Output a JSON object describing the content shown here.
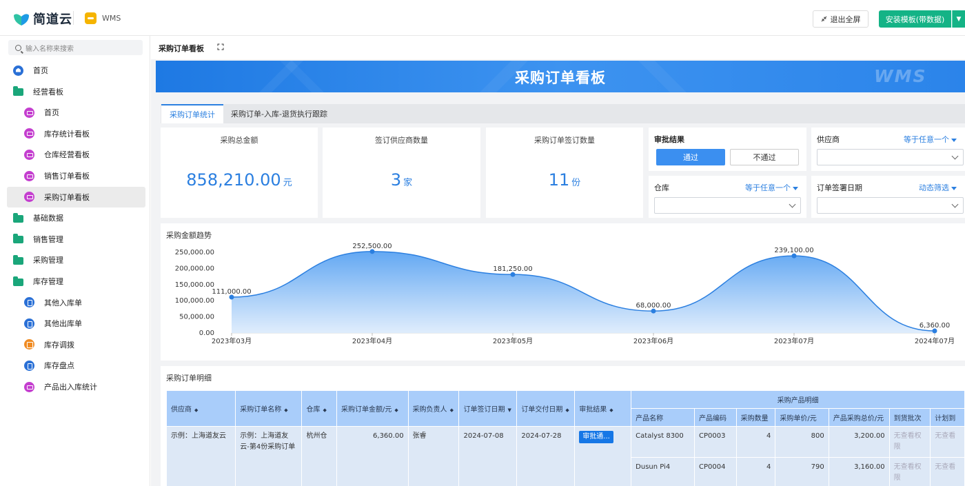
{
  "brand": {
    "name": "简道云",
    "app": "WMS"
  },
  "topbar": {
    "exit_label": "退出全屏",
    "install_label": "安装模板(带数据)"
  },
  "sidebar": {
    "search_placeholder": "输入名称来搜索",
    "items": [
      {
        "label": "首页",
        "icon": "home-icon"
      },
      {
        "label": "经营看板",
        "icon": "folder-icon"
      },
      {
        "label": "首页",
        "icon": "message-icon"
      },
      {
        "label": "库存统计看板",
        "icon": "message-icon"
      },
      {
        "label": "仓库经营看板",
        "icon": "message-icon"
      },
      {
        "label": "销售订单看板",
        "icon": "message-icon"
      },
      {
        "label": "采购订单看板",
        "icon": "message-icon",
        "active": true
      },
      {
        "label": "基础数据",
        "icon": "folder-icon"
      },
      {
        "label": "销售管理",
        "icon": "folder-icon"
      },
      {
        "label": "采购管理",
        "icon": "folder-icon"
      },
      {
        "label": "库存管理",
        "icon": "folder-icon"
      },
      {
        "label": "其他入库单",
        "icon": "document-icon"
      },
      {
        "label": "其他出库单",
        "icon": "document-icon"
      },
      {
        "label": "库存调拨",
        "icon": "swap-icon"
      },
      {
        "label": "库存盘点",
        "icon": "document-icon"
      },
      {
        "label": "产品出入库统计",
        "icon": "message-icon"
      }
    ]
  },
  "page": {
    "tab_title": "采购订单看板",
    "banner_title": "采购订单看板",
    "banner_watermark": "WMS",
    "tabs": [
      "采购订单统计",
      "采购订单-入库-退货执行跟踪"
    ]
  },
  "kpis": [
    {
      "label": "采购总金额",
      "value": "858,210.00",
      "unit": "元"
    },
    {
      "label": "签订供应商数量",
      "value": "3",
      "unit": "家"
    },
    {
      "label": "采购订单签订数量",
      "value": "11",
      "unit": "份"
    }
  ],
  "filters": {
    "approval": {
      "title": "审批结果",
      "pass": "通过",
      "fail": "不通过"
    },
    "supplier": {
      "title": "供应商",
      "op": "等于任意一个"
    },
    "warehouse": {
      "title": "仓库",
      "op": "等于任意一个"
    },
    "sign_date": {
      "title": "订单签署日期",
      "op": "动态筛选"
    }
  },
  "chart_data": {
    "type": "area",
    "title": "采购金额趋势",
    "x": [
      "2023年03月",
      "2023年04月",
      "2023年05月",
      "2023年06月",
      "2023年07月",
      "2024年07月"
    ],
    "values": [
      111000,
      252500,
      181250,
      68000,
      239100,
      6360
    ],
    "data_labels": [
      "111,000.00",
      "252,500.00",
      "181,250.00",
      "68,000.00",
      "239,100.00",
      "6,360.00"
    ],
    "yticks": [
      "250,000.00",
      "200,000.00",
      "150,000.00",
      "100,000.00",
      "50,000.00",
      "0.00"
    ],
    "ylim": [
      0,
      250000
    ],
    "color": "#2b7fe0"
  },
  "table": {
    "title": "采购订单明细",
    "group_header": "采购产品明细",
    "headers": [
      "供应商",
      "采购订单名称",
      "仓库",
      "采购订单金额/元",
      "采购负责人",
      "订单签订日期",
      "订单交付日期",
      "审批结果"
    ],
    "sub_headers": [
      "产品名称",
      "产品编码",
      "采购数量",
      "采购单价/元",
      "产品采购总价/元",
      "到货批次",
      "计划到"
    ],
    "row": {
      "supplier": "示例：上海道友云",
      "order_name": "示例：上海道友云-第4份采购订单",
      "warehouse": "杭州仓",
      "amount": "6,360.00",
      "owner": "张睿",
      "sign_date": "2024-07-08",
      "delivery_date": "2024-07-28",
      "approval": "审批通..."
    },
    "products": [
      {
        "name": "Catalyst 8300",
        "code": "CP0003",
        "qty": "4",
        "price": "800",
        "total": "3,200.00",
        "batch": "无查看权限",
        "plan": "无查看"
      },
      {
        "name": "Dusun Pi4",
        "code": "CP0004",
        "qty": "4",
        "price": "790",
        "total": "3,160.00",
        "batch": "无查看权限",
        "plan": "无查看"
      }
    ]
  }
}
